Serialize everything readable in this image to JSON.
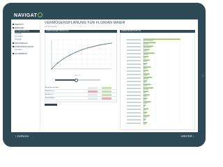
{
  "app": {
    "logo_text": "NAVIGAT",
    "logo_ring": "O"
  },
  "sidebar": {
    "items": [
      {
        "label": "ÜBERSICHT",
        "level": 0,
        "active": false
      },
      {
        "label": "VERMÖGEN",
        "level": 0,
        "active": false
      },
      {
        "label": "Vermögensplanung",
        "level": 1,
        "active": true
      },
      {
        "label": "Liquidität",
        "level": 1,
        "active": false
      },
      {
        "label": "Immobilien",
        "level": 1,
        "active": false
      },
      {
        "label": "Vorsorge",
        "level": 1,
        "active": false
      },
      {
        "label": "VERSICHERUNG",
        "level": 0,
        "active": false
      },
      {
        "label": "RUHESTANDSPLANUNG",
        "level": 0,
        "active": false
      },
      {
        "label": "Szenarien",
        "level": 1,
        "active": false
      },
      {
        "label": "FINANZBERICHT",
        "level": 0,
        "active": false
      }
    ]
  },
  "main": {
    "title": "VERMÖGENSPLANUNG FÜR FLORIAN MAIER",
    "subtitle": "per 31.12.2022",
    "left_panel_title": "VERMÖGENSENTWICKLUNG",
    "right_panel_title": "VERMÖGENSSTRUKTUR",
    "slider_label": "Alter: 62",
    "summary_rows": [
      {
        "label": "Ausgangsvermögen",
        "a": "",
        "b": ""
      },
      {
        "label": "Sparrate p.a.",
        "a": "",
        "b": ""
      },
      {
        "label": "Rendite p.a.",
        "a": "",
        "b": ""
      },
      {
        "label": "Endvermögen",
        "a": "",
        "b": ""
      }
    ]
  },
  "footer": {
    "back_label": "ZURÜCK",
    "next_label": "WEITER"
  },
  "colors": {
    "primary": "#2f4a57",
    "accent_green": "#8fbf5a",
    "light_green": "#c8dfae",
    "pink": "#e9a9b4",
    "line": "#4c6a78"
  },
  "chart_data": [
    {
      "type": "line",
      "series": [
        {
          "values": [
            0,
            12,
            21,
            28,
            34,
            39,
            43,
            46,
            49,
            51,
            53
          ]
        }
      ],
      "x": [
        0,
        1,
        2,
        3,
        4,
        5,
        6,
        7,
        8,
        9,
        10
      ],
      "ylim": [
        0,
        60
      ],
      "grid": true
    },
    {
      "type": "bar",
      "categories": [
        "a",
        "b",
        "c",
        "d",
        "e",
        "f",
        "g",
        "h",
        "i",
        "j",
        "k",
        "l",
        "m",
        "n",
        "o",
        "p",
        "q",
        "r",
        "s",
        "t",
        "u",
        "v",
        "w",
        "x",
        "y"
      ],
      "series": [
        {
          "values": [
            30,
            10,
            8,
            5,
            9,
            4,
            5,
            3,
            6,
            4,
            5,
            7,
            3,
            6,
            8,
            4,
            5,
            3,
            6,
            2,
            4,
            3,
            5,
            2,
            3
          ]
        },
        {
          "values": [
            8,
            4,
            6,
            3,
            4,
            2,
            3,
            2,
            3,
            2,
            3,
            4,
            2,
            3,
            4,
            2,
            3,
            2,
            3,
            1,
            2,
            2,
            3,
            1,
            2
          ]
        }
      ],
      "grid": true
    }
  ]
}
